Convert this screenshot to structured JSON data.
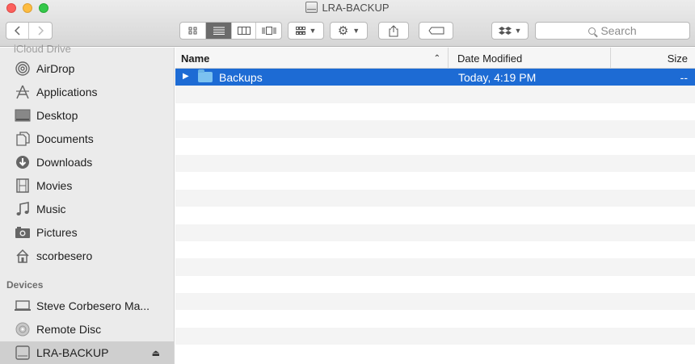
{
  "window": {
    "title": "LRA-BACKUP"
  },
  "toolbar": {
    "back_icon": "chevron-left-icon",
    "forward_icon": "chevron-right-icon",
    "view_modes": [
      "icon-view",
      "list-view",
      "column-view",
      "cover-flow-view"
    ],
    "active_view": "list-view",
    "search_placeholder": "Search"
  },
  "sidebar": {
    "partial_top_item": "iCloud Drive",
    "favorites": [
      {
        "label": "AirDrop",
        "icon": "airdrop-icon"
      },
      {
        "label": "Applications",
        "icon": "applications-icon"
      },
      {
        "label": "Desktop",
        "icon": "desktop-icon"
      },
      {
        "label": "Documents",
        "icon": "documents-icon"
      },
      {
        "label": "Downloads",
        "icon": "downloads-icon"
      },
      {
        "label": "Movies",
        "icon": "movies-icon"
      },
      {
        "label": "Music",
        "icon": "music-icon"
      },
      {
        "label": "Pictures",
        "icon": "pictures-icon"
      },
      {
        "label": "scorbesero",
        "icon": "home-icon"
      }
    ],
    "devices_heading": "Devices",
    "devices": [
      {
        "label": "Steve Corbesero Ma...",
        "icon": "laptop-icon"
      },
      {
        "label": "Remote Disc",
        "icon": "disc-icon"
      },
      {
        "label": "LRA-BACKUP",
        "icon": "drive-icon",
        "selected": true
      }
    ]
  },
  "columns": {
    "name": "Name",
    "date": "Date Modified",
    "size": "Size"
  },
  "files": [
    {
      "name": "Backups",
      "date": "Today, 4:19 PM",
      "size": "--",
      "selected": true
    }
  ]
}
